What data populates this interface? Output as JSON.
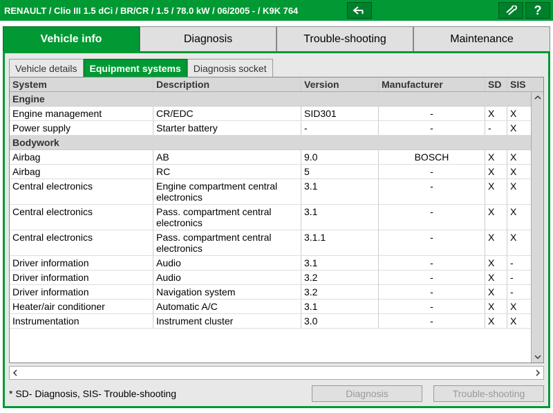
{
  "titlebar": {
    "title": "RENAULT / Clio III 1.5 dCi / BR/CR / 1.5 / 78.0 kW / 06/2005 -  / K9K 764"
  },
  "main_tabs": [
    "Vehicle info",
    "Diagnosis",
    "Trouble-shooting",
    "Maintenance"
  ],
  "main_tabs_active": 0,
  "sub_tabs": [
    "Vehicle details",
    "Equipment systems",
    "Diagnosis socket"
  ],
  "sub_tabs_active": 1,
  "columns": {
    "system": "System",
    "description": "Description",
    "version": "Version",
    "manufacturer": "Manufacturer",
    "sd": "SD",
    "sis": "SIS"
  },
  "groups": [
    {
      "name": "Engine",
      "rows": [
        {
          "system": "Engine management",
          "description": "CR/EDC",
          "version": "SID301",
          "manufacturer": "-",
          "sd": "X",
          "sis": "X"
        },
        {
          "system": "Power supply",
          "description": "Starter battery",
          "version": "-",
          "manufacturer": "-",
          "sd": "-",
          "sis": "X"
        }
      ]
    },
    {
      "name": "Bodywork",
      "rows": [
        {
          "system": "Airbag",
          "description": "AB",
          "version": "9.0",
          "manufacturer": "BOSCH",
          "sd": "X",
          "sis": "X"
        },
        {
          "system": "Airbag",
          "description": "RC",
          "version": "5",
          "manufacturer": "-",
          "sd": "X",
          "sis": "X"
        },
        {
          "system": "Central electronics",
          "description": "Engine compartment central electronics",
          "version": "3.1",
          "manufacturer": "-",
          "sd": "X",
          "sis": "X"
        },
        {
          "system": "Central electronics",
          "description": "Pass. compartment central electronics",
          "version": "3.1",
          "manufacturer": "-",
          "sd": "X",
          "sis": "X"
        },
        {
          "system": "Central electronics",
          "description": "Pass. compartment central electronics",
          "version": "3.1.1",
          "manufacturer": "-",
          "sd": "X",
          "sis": "X"
        },
        {
          "system": "Driver information",
          "description": "Audio",
          "version": "3.1",
          "manufacturer": "-",
          "sd": "X",
          "sis": "-"
        },
        {
          "system": "Driver information",
          "description": "Audio",
          "version": "3.2",
          "manufacturer": "-",
          "sd": "X",
          "sis": "-"
        },
        {
          "system": "Driver information",
          "description": "Navigation system",
          "version": "3.2",
          "manufacturer": "-",
          "sd": "X",
          "sis": "-"
        },
        {
          "system": "Heater/air conditioner",
          "description": "Automatic A/C",
          "version": "3.1",
          "manufacturer": "-",
          "sd": "X",
          "sis": "X"
        },
        {
          "system": "Instrumentation",
          "description": "Instrument cluster",
          "version": "3.0",
          "manufacturer": "-",
          "sd": "X",
          "sis": "X"
        }
      ]
    }
  ],
  "legend": "* SD- Diagnosis, SIS- Trouble-shooting",
  "buttons": {
    "diagnosis": "Diagnosis",
    "troubleshooting": "Trouble-shooting"
  }
}
